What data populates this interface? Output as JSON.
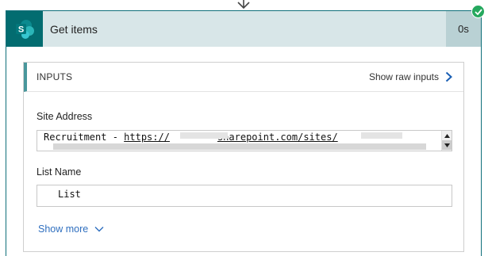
{
  "card": {
    "title": "Get items",
    "duration": "0s",
    "connector_icon": "down-arrow-icon",
    "app_icon": "sharepoint-icon",
    "app_icon_letter": "S",
    "status_icon": "success-check-icon",
    "colors": {
      "header_bg": "#d8e6e8",
      "duration_bg": "#b9d1d4",
      "brand": "#036c70",
      "success": "#25a85e",
      "link": "#2f6fbf"
    }
  },
  "inputs": {
    "title": "INPUTS",
    "show_raw_label": "Show raw inputs",
    "site_address_label": "Site Address",
    "site_address_parts": {
      "prefix": "Recruitment - ",
      "url_start": "https://",
      "url_mid": "sharepoint.com/sites/",
      "url_end": "-"
    },
    "list_name_label": "List Name",
    "list_name_value": "List",
    "show_more_label": "Show more"
  }
}
